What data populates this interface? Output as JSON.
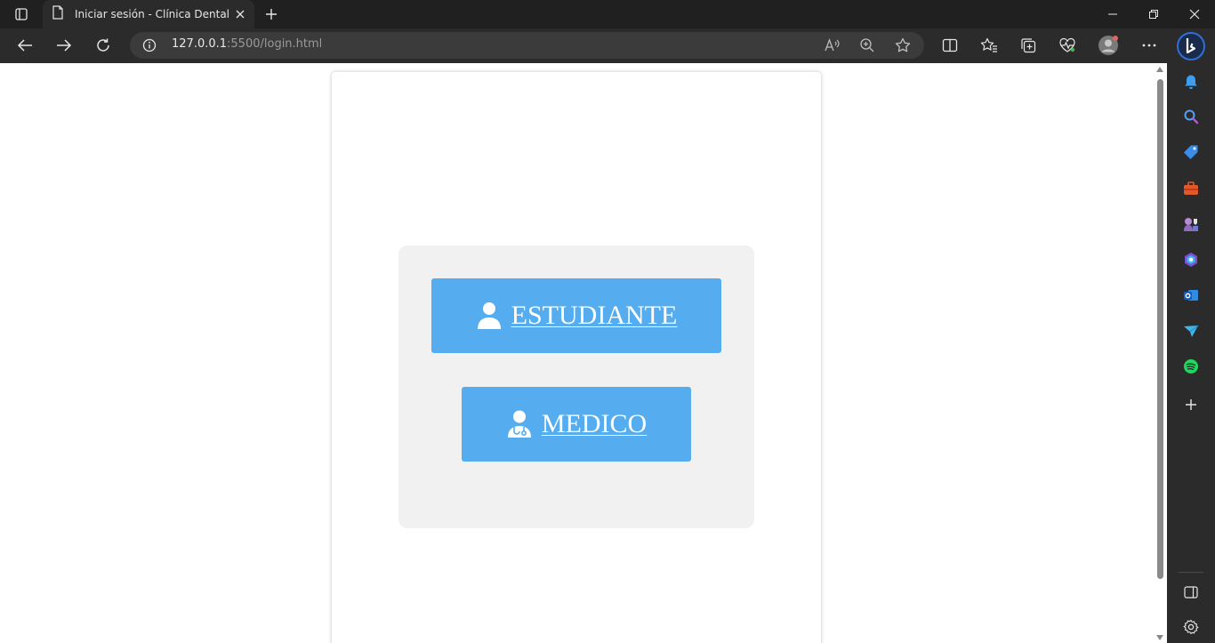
{
  "browser": {
    "tab_title": "Iniciar sesión - Clínica Dental",
    "url_host": "127.0.0.1",
    "url_rest": ":5500/login.html"
  },
  "toolbar_icons": [
    "back-icon",
    "forward-icon",
    "refresh-icon",
    "info-icon",
    "read-aloud-icon",
    "zoom-icon",
    "favorite-star-icon",
    "split-screen-icon",
    "favorites-icon",
    "collections-icon",
    "performance-icon",
    "profile-avatar",
    "more-menu-icon",
    "bing-copilot-icon"
  ],
  "sidebar_icons": [
    "bell-icon",
    "search-icon",
    "shopping-tag-icon",
    "tools-icon",
    "games-icon",
    "microsoft365-icon",
    "outlook-icon",
    "send-icon",
    "spotify-icon",
    "add-icon",
    "sidebar-toggle-icon",
    "settings-icon"
  ],
  "login": {
    "student_label": "ESTUDIANTE",
    "medico_label": "MEDICO"
  },
  "colors": {
    "button_bg": "#55acee",
    "panel_bg": "#f1f1f1",
    "browser_chrome": "#2b2b2b"
  }
}
